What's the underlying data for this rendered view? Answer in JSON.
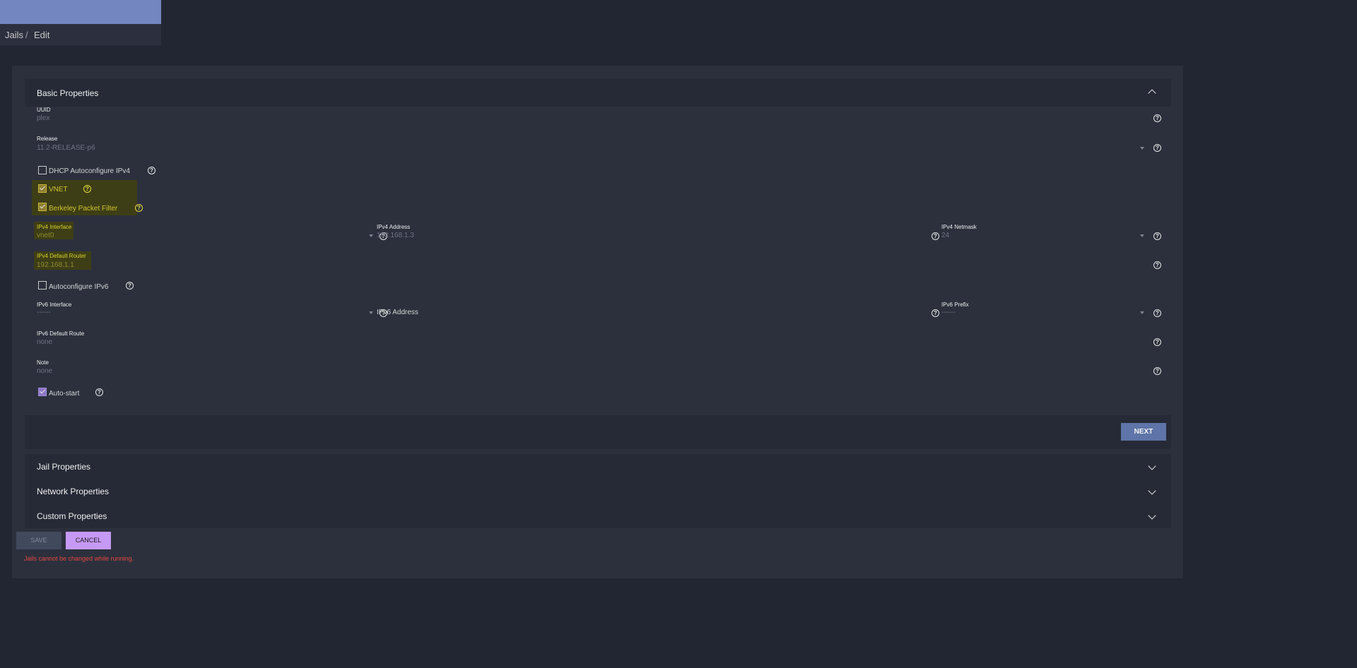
{
  "breadcrumb": {
    "root": "Jails",
    "separator": "/",
    "current": "Edit"
  },
  "basic_properties": {
    "title": "Basic Properties",
    "uuid": {
      "label": "UUID",
      "value": "plex"
    },
    "release": {
      "label": "Release",
      "value": "11.2-RELEASE-p6"
    },
    "dhcp": {
      "label": "DHCP Autoconfigure IPv4",
      "checked": false
    },
    "vnet": {
      "label": "VNET",
      "checked": true
    },
    "bpf": {
      "label": "Berkeley Packet Filter",
      "checked": true
    },
    "ipv4_interface": {
      "label": "IPv4 Interface",
      "value": "vnet0"
    },
    "ipv4_address": {
      "label": "IPv4 Address",
      "value": "192.168.1.3"
    },
    "ipv4_netmask": {
      "label": "IPv4 Netmask",
      "value": "24"
    },
    "ipv4_router": {
      "label": "IPv4 Default Router",
      "value": "192.168.1.1"
    },
    "autoconf_ipv6": {
      "label": "Autoconfigure IPv6",
      "checked": false
    },
    "ipv6_interface": {
      "label": "IPv6 Interface",
      "value": "------"
    },
    "ipv6_address": {
      "label": "IPv6 Address"
    },
    "ipv6_prefix": {
      "label": "IPv6 Prefix",
      "value": "------"
    },
    "ipv6_route": {
      "label": "IPv6 Default Route",
      "value": "none"
    },
    "note": {
      "label": "Note",
      "value": "none"
    },
    "autostart": {
      "label": "Auto-start",
      "checked": true
    },
    "next_label": "NEXT"
  },
  "sections": {
    "jail": "Jail Properties",
    "network": "Network Properties",
    "custom": "Custom Properties"
  },
  "actions": {
    "save_label": "SAVE",
    "cancel_label": "CANCEL"
  },
  "error_message": "Jails cannot be changed while running.",
  "colors": {
    "accent": "#7486c0",
    "highlight": "#d6d22a",
    "error": "#e2473f",
    "cancel": "#c699f5",
    "next": "#5f74a8"
  }
}
